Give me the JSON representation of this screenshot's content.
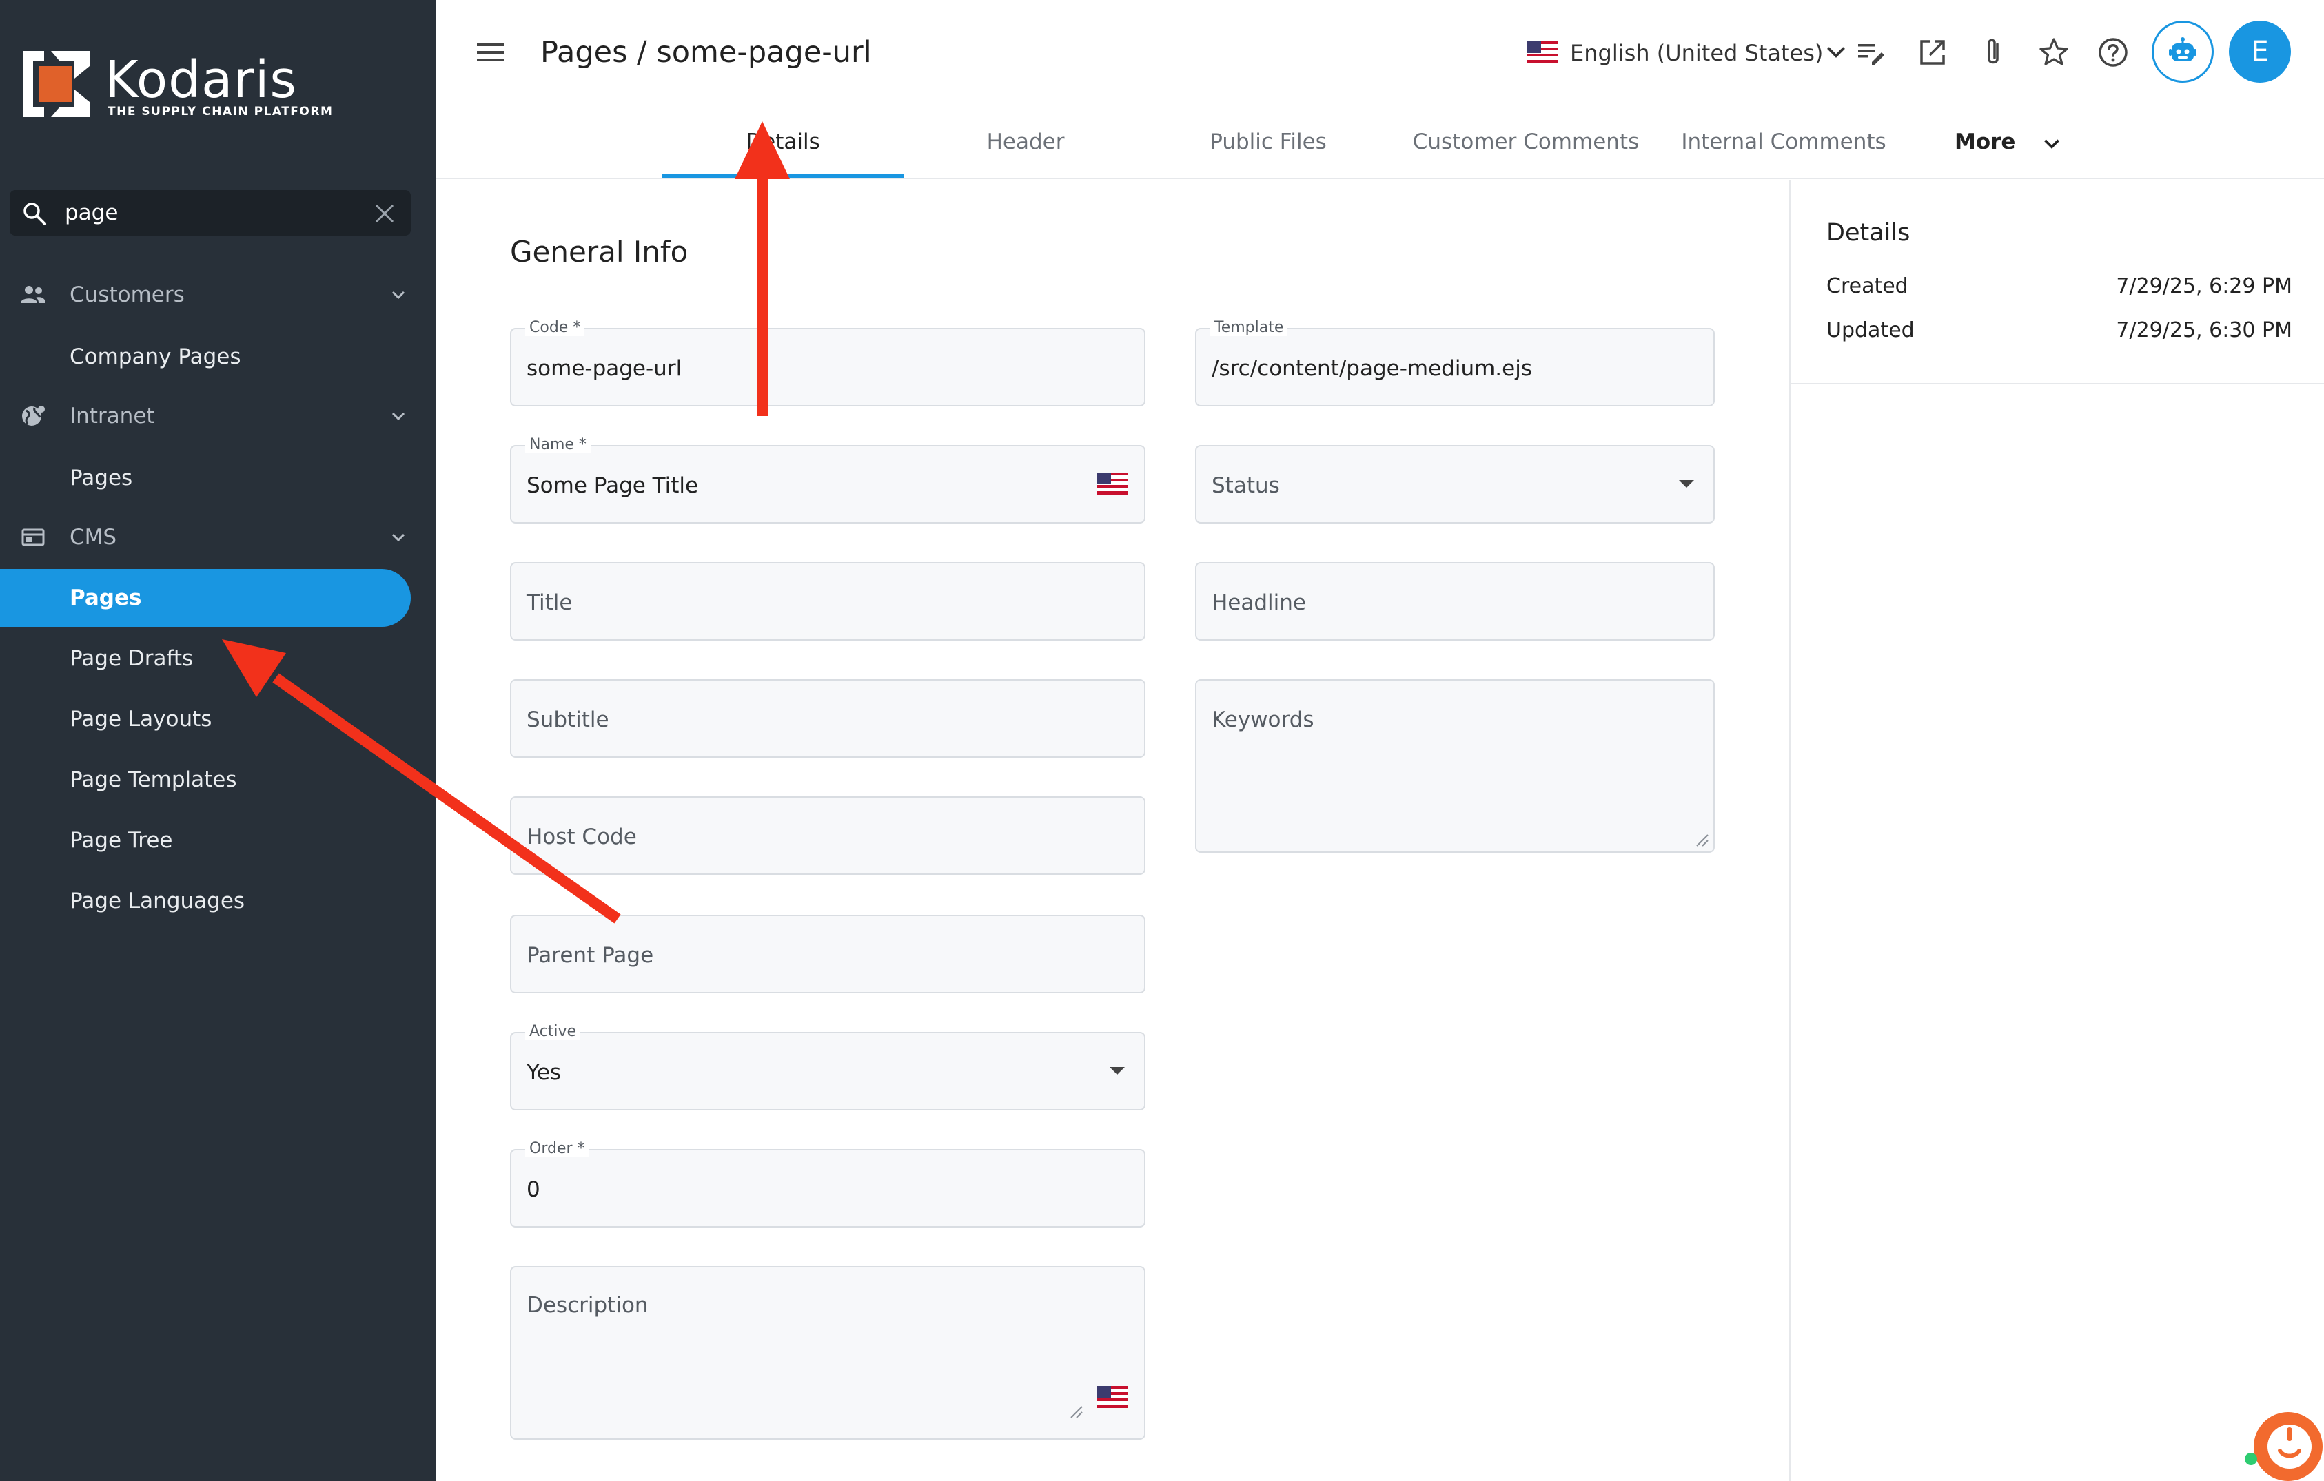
{
  "app": {
    "logo_text": "Kodaris",
    "logo_tagline": "THE SUPPLY CHAIN PLATFORM",
    "colors": {
      "sidebar_bg": "#283039",
      "accent": "#1996e1",
      "arrow": "#f2311b"
    }
  },
  "sidebar": {
    "search": {
      "value": "page",
      "icon": "search-icon",
      "clear_icon": "close-icon"
    },
    "groups": [
      {
        "label": "Customers",
        "icon": "people-icon",
        "items": [
          {
            "label": "Company Pages"
          }
        ]
      },
      {
        "label": "Intranet",
        "icon": "globe-icon",
        "items": [
          {
            "label": "Pages"
          }
        ]
      },
      {
        "label": "CMS",
        "icon": "cms-icon",
        "items": [
          {
            "label": "Pages",
            "active": true
          },
          {
            "label": "Page Drafts"
          },
          {
            "label": "Page Layouts"
          },
          {
            "label": "Page Templates"
          },
          {
            "label": "Page Tree"
          },
          {
            "label": "Page Languages"
          }
        ]
      }
    ]
  },
  "header": {
    "title": "Pages / some-page-url",
    "language": "English (United States)",
    "avatar_letter": "E",
    "toolbar_icons": [
      "edit-list-icon",
      "open-external-icon",
      "attachment-icon",
      "star-icon",
      "help-icon",
      "bot-icon"
    ]
  },
  "tabs": [
    {
      "label": "Details",
      "active": true
    },
    {
      "label": "Header"
    },
    {
      "label": "Public Files"
    },
    {
      "label": "Customer Comments"
    },
    {
      "label": "Internal Comments"
    },
    {
      "label": "More"
    }
  ],
  "form": {
    "section_title": "General Info",
    "code": {
      "label": "Code *",
      "value": "some-page-url"
    },
    "template": {
      "label": "Template",
      "value": "/src/content/page-medium.ejs"
    },
    "name": {
      "label": "Name *",
      "value": "Some Page Title"
    },
    "status": {
      "placeholder": "Status"
    },
    "title": {
      "placeholder": "Title"
    },
    "headline": {
      "placeholder": "Headline"
    },
    "subtitle": {
      "placeholder": "Subtitle"
    },
    "keywords": {
      "placeholder": "Keywords"
    },
    "host_code": {
      "placeholder": "Host Code"
    },
    "parent_page": {
      "placeholder": "Parent Page"
    },
    "active": {
      "label": "Active",
      "value": "Yes"
    },
    "order": {
      "label": "Order *",
      "value": "0"
    },
    "description": {
      "placeholder": "Description"
    }
  },
  "details_panel": {
    "title": "Details",
    "created_label": "Created",
    "created_value": "7/29/25, 6:29 PM",
    "updated_label": "Updated",
    "updated_value": "7/29/25, 6:30 PM"
  }
}
